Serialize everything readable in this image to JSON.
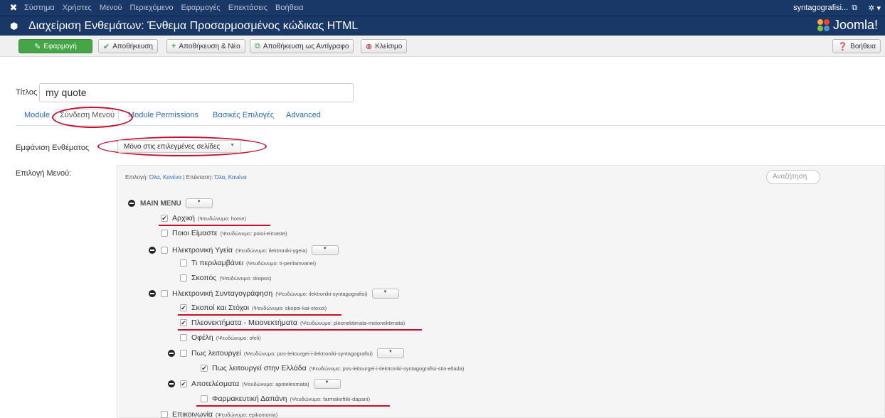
{
  "topbar": {
    "menu": [
      "Σύστημα",
      "Χρήστες",
      "Μενού",
      "Περιεχόμενο",
      "Εφαρμογές",
      "Επεκτάσεις",
      "Βοήθεια"
    ],
    "site": "syntagografisi...",
    "site_icon": "external-link-icon",
    "gear_icon": "gear-icon"
  },
  "header": {
    "title": "Διαχείριση Ενθεμάτων: Ένθεμα Προσαρμοσμένος κώδικας HTML",
    "brand": "Joomla!"
  },
  "toolbar": {
    "apply": "Εφαρμογή",
    "save": "Αποθήκευση",
    "save_new": "Αποθήκευση & Νέο",
    "save_copy": "Αποθήκευση ως Αντίγραφο",
    "close": "Κλείσιμο",
    "help": "Βοήθεια"
  },
  "form": {
    "title_label": "Τίτλος *",
    "title_value": "my quote"
  },
  "tabs": [
    "Module",
    "Σύνδεση Μενού",
    "Module Permissions",
    "Βασικές Επιλογές",
    "Advanced"
  ],
  "assignment": {
    "label": "Εμφάνιση Ενθέματος",
    "value": "Μόνο στις επιλεγμένες σελίδες",
    "menu_label": "Επιλογή Μενού:"
  },
  "panel": {
    "select_prefix": "Επιλογή:",
    "all": "Όλα,",
    "none": "Κανένα",
    "expand_prefix": "| Επέκταση:",
    "search_placeholder": "Αναζήτηση"
  },
  "menu_tree": {
    "main_menu": "MAIN MENU",
    "alias_prefix": "(Ψευδώνυμο:",
    "items": [
      {
        "label": "Αρχική",
        "alias": "home)",
        "checked": true
      },
      {
        "label": "Ποιοι Είμαστε",
        "alias": "poioi-eimaste)",
        "checked": false
      },
      {
        "label": "Ηλεκτρονική Υγεία",
        "alias": "ilektroniki-ygeia)",
        "checked": false
      },
      {
        "label": "Τι περιλαμβάνει",
        "alias": "ti-perilamvanei)",
        "checked": false
      },
      {
        "label": "Σκοπός",
        "alias": "skopos)",
        "checked": false
      },
      {
        "label": "Ηλεκτρονική Συνταγογράφηση",
        "alias": "ilektroniki-syntagografisi)",
        "checked": false
      },
      {
        "label": "Σκοποί και Στόχοι",
        "alias": "skopoi-kai-stoxoi)",
        "checked": true
      },
      {
        "label": "Πλεονεκτήματα - Μειονεκτήματα",
        "alias": "pleonektimata-meionektimata)",
        "checked": true
      },
      {
        "label": "Οφέλη",
        "alias": "ofeli)",
        "checked": false
      },
      {
        "label": "Πως λειτουργεί",
        "alias": "pos-leitourgei-i-ilektroniki-syntagografisi)",
        "checked": false
      },
      {
        "label": "Πως λειτουργεί στην Ελλάδα",
        "alias": "pos-leitourgei-i-ilektroniki-syntagografisi-stin-ellada)",
        "checked": true
      },
      {
        "label": "Αποτελέσματα",
        "alias": "apotelesmata)",
        "checked": true
      },
      {
        "label": "Φαρμακευτική Δαπάνη",
        "alias": "farmakeftiki-dapani)",
        "checked": false
      },
      {
        "label": "Επικοινωνία",
        "alias": "epikoinonia)",
        "checked": false
      }
    ]
  },
  "colors": {
    "navbar": "#1a3867",
    "apply_green": "#46a546",
    "link_blue": "#2a69b8",
    "annotation_red": "#c8102e"
  }
}
